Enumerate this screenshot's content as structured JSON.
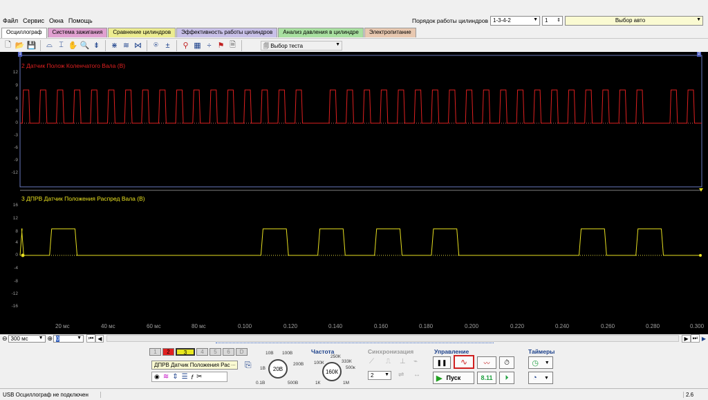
{
  "menu": [
    "Файл",
    "Сервис",
    "Окна",
    "Помощь"
  ],
  "cyl_order_label": "Порядок работы цилиндров",
  "cyl_order_value": "1-3-4-2",
  "cyl_number": "1",
  "auto_select": "Выбор авто",
  "tabs": [
    {
      "label": "Осциллограф",
      "color": "#ffffff"
    },
    {
      "label": "Система зажигания",
      "color": "#e0a0d0"
    },
    {
      "label": "Сравнение цилиндров",
      "color": "#ecec90"
    },
    {
      "label": "Эффективность работы цилиндров",
      "color": "#c8c0e8"
    },
    {
      "label": "Анализ давления в цилиндре",
      "color": "#a8e0a0"
    },
    {
      "label": "Электропитание",
      "color": "#e8c8b0"
    }
  ],
  "toolbar_test": "Выбор теста",
  "ch2": {
    "label": "2 Датчик Полож Коленчатого Вала (В)",
    "color": "#e02020",
    "ticks": [
      "12",
      "9",
      "6",
      "3",
      "0",
      "-3",
      "-6",
      "-9",
      "-12"
    ]
  },
  "ch3": {
    "label": "3 ДПРВ Датчик Положения Распред Вала (В)",
    "color": "#e8e020",
    "ticks": [
      "16",
      "12",
      "8",
      "4",
      "0",
      "-4",
      "-8",
      "-12",
      "-16"
    ]
  },
  "xticks": [
    "20 мс",
    "40 мс",
    "60 мс",
    "80 мс",
    "0.100",
    "0.120",
    "0.140",
    "0.160",
    "0.180",
    "0.200",
    "0.220",
    "0.240",
    "0.260",
    "0.280",
    "0.300"
  ],
  "marker_left": "1",
  "marker_right": "2",
  "chart_data": [
    {
      "type": "line",
      "title": "2 Датчик Полож Коленчатого Вала (В)",
      "ylim": [
        -15,
        15
      ],
      "xlim": [
        0,
        0.3
      ],
      "series": [
        {
          "name": "2 Датчик Полож Коленчатого Вала (В)",
          "high": 8,
          "low": 0,
          "pulse_starts_s": [
            0.001,
            0.0085,
            0.016,
            0.0235,
            0.031,
            0.0385,
            0.046,
            0.0535,
            0.061,
            0.0685,
            0.076,
            0.0835,
            0.091,
            0.0985,
            0.106,
            0.1135,
            0.121,
            0.1285,
            0.136,
            0.1435,
            0.151,
            0.1585,
            0.166,
            0.1735,
            0.181,
            0.1885,
            0.196,
            0.2035,
            0.211,
            0.2185,
            0.226,
            0.2335,
            0.241,
            0.2485,
            0.256,
            0.2635,
            0.271,
            0.2785,
            0.286,
            0.2935
          ],
          "missing_pulse_s": [
            0.1285,
            0.2785
          ]
        }
      ]
    },
    {
      "type": "line",
      "title": "3 ДПРВ Датчик Положения Распред Вала (В)",
      "ylim": [
        -20,
        20
      ],
      "xlim": [
        0,
        0.3
      ],
      "series": [
        {
          "name": "3 ДПРВ Датчик Положения Распред Вала (В)",
          "high": 8.5,
          "low": 0,
          "pulses_s": [
            [
              0.0,
              0.001
            ],
            [
              0.013,
              0.0245
            ],
            [
              0.106,
              0.1175
            ],
            [
              0.131,
              0.1425
            ],
            [
              0.156,
              0.1675
            ],
            [
              0.181,
              0.1925
            ],
            [
              0.246,
              0.2575
            ],
            [
              0.271,
              0.2825
            ]
          ]
        }
      ]
    }
  ],
  "timebase": "300 мс",
  "zoom": "0",
  "channels": [
    "1",
    "2",
    "3",
    "4",
    "5",
    "6",
    "D"
  ],
  "channel_select": "ДПРВ Датчик Положения Рас",
  "volts_knob": {
    "value": "20В",
    "labels": [
      "10В",
      "100В",
      "1В",
      "200В",
      "0.1В",
      "500В"
    ]
  },
  "freq_title": "Частота",
  "freq_knob": {
    "value": "160К",
    "labels": [
      "250К",
      "100К",
      "333К",
      "500к",
      "1К",
      "1М"
    ]
  },
  "sync_title": "Синхронизация",
  "sync_value": "2",
  "control_title": "Управление",
  "start_label": "Пуск",
  "version": "8.11",
  "timers_title": "Таймеры",
  "status_text": "USB Осциллограф не подключен",
  "status_right": "2.6"
}
